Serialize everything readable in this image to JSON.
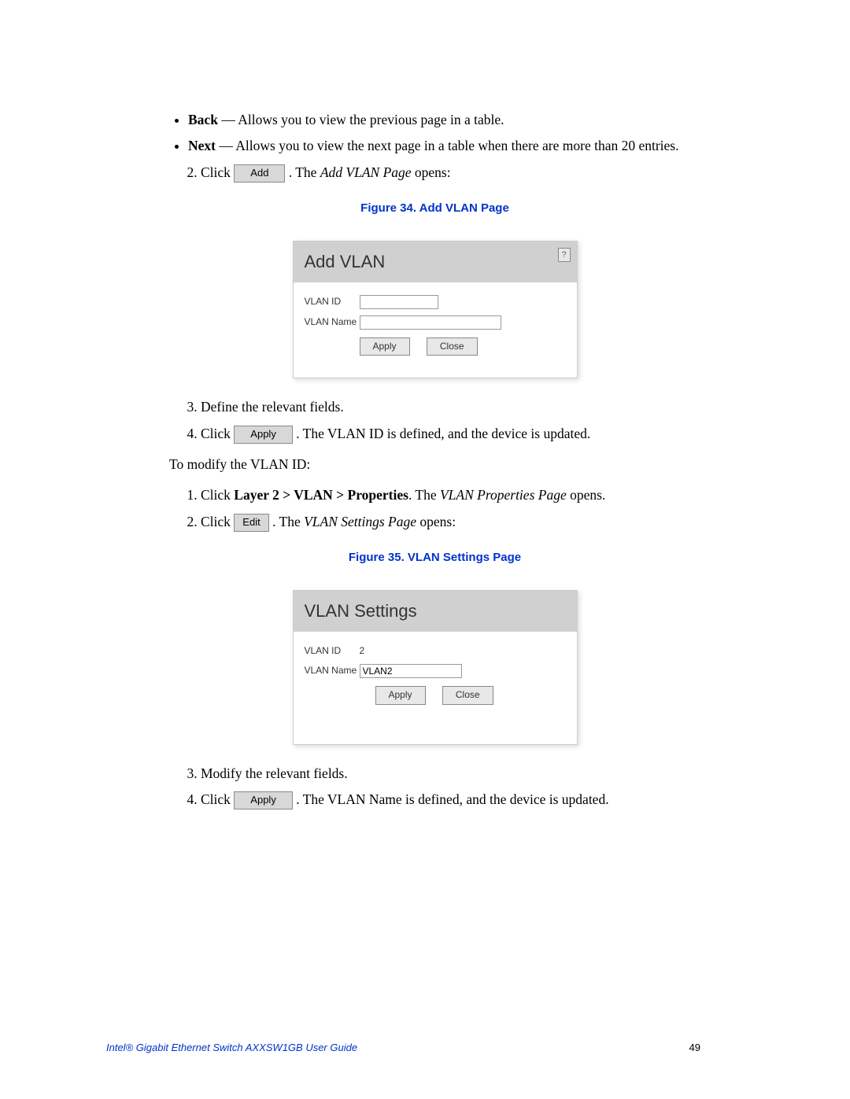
{
  "bullets": [
    {
      "label": "Back",
      "desc": " — Allows you to view the previous page in a table."
    },
    {
      "label": "Next",
      "desc": " — Allows you to view the next page in a table when there are more than 20 entries."
    }
  ],
  "step2": {
    "num": "2.",
    "prefix": "Click ",
    "btn": "Add",
    "mid": ". The ",
    "italic": "Add VLAN Page",
    "suffix": " opens:"
  },
  "fig34_caption": "Figure 34. Add VLAN Page",
  "fig34": {
    "title": "Add VLAN",
    "help": "?",
    "label_id": "VLAN ID",
    "label_name": "VLAN Name",
    "apply": "Apply",
    "close": "Close"
  },
  "step3": "Define the relevant fields.",
  "step4": {
    "prefix": "Click ",
    "btn": "Apply",
    "suffix": ". The VLAN ID is defined, and the device is updated."
  },
  "modify_intro": "To modify the VLAN ID:",
  "mstep1": {
    "prefix": "Click ",
    "bold": "Layer 2 > VLAN > Properties",
    "mid": ". The ",
    "italic": "VLAN Properties Page",
    "suffix": " opens."
  },
  "mstep2": {
    "prefix": "Click ",
    "btn": "Edit",
    "mid": ". The ",
    "italic": "VLAN Settings Page",
    "suffix": " opens:"
  },
  "fig35_caption": "Figure 35. VLAN Settings Page",
  "fig35": {
    "title": "VLAN Settings",
    "label_id": "VLAN ID",
    "value_id": "2",
    "label_name": "VLAN Name",
    "value_name": "VLAN2",
    "apply": "Apply",
    "close": "Close"
  },
  "mstep3": "Modify the relevant fields.",
  "mstep4": {
    "prefix": "Click ",
    "btn": "Apply",
    "suffix": ". The VLAN Name is defined, and the device is updated."
  },
  "footer_left": "Intel® Gigabit Ethernet Switch AXXSW1GB User Guide",
  "footer_right": "49"
}
